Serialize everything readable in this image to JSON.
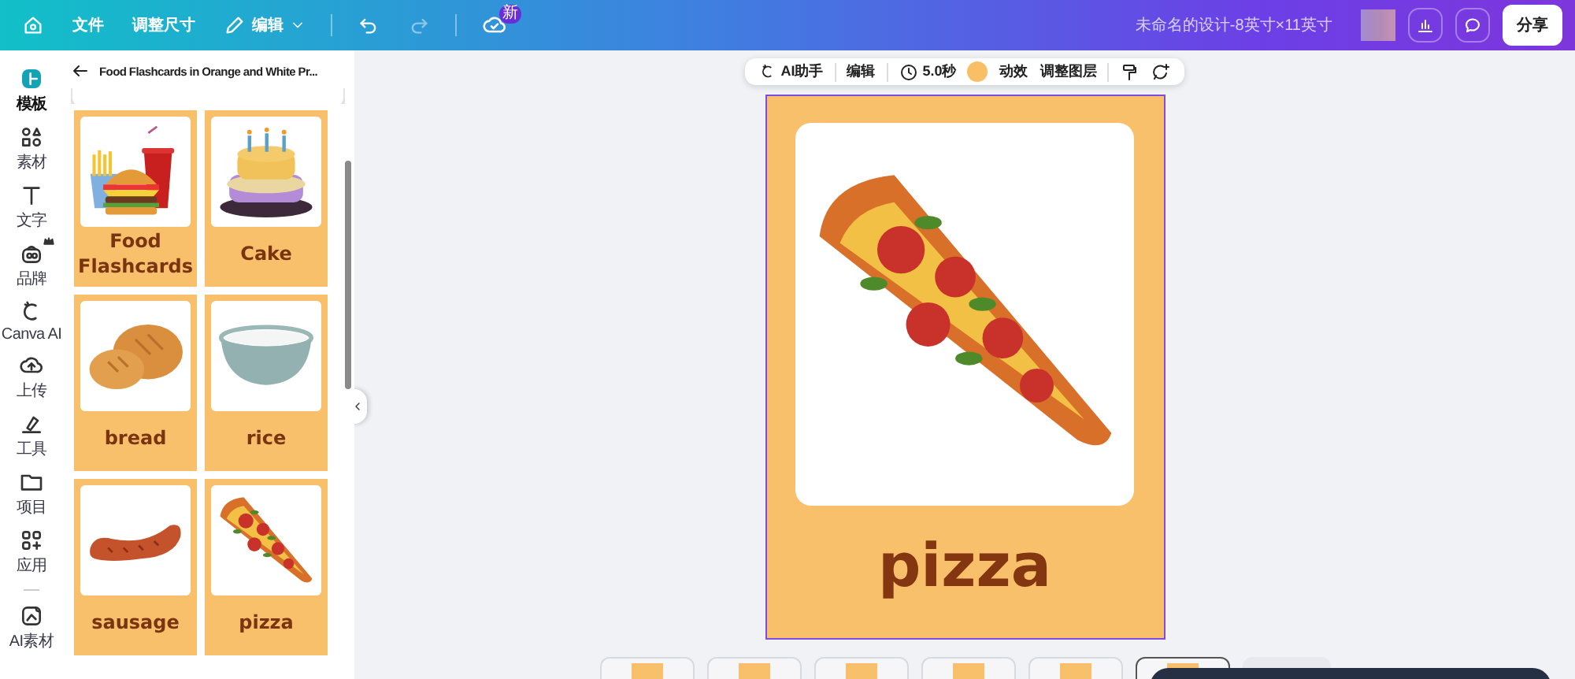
{
  "topbar": {
    "menu": [
      {
        "label": "文件"
      },
      {
        "label": "调整尺寸"
      }
    ],
    "edit_menu": {
      "label": "编辑"
    },
    "undo": {
      "disabled": false
    },
    "redo": {
      "disabled": true
    },
    "cloud_badge": "新",
    "design_title": "未命名的设计-8英寸×11英寸",
    "share_button": "分享"
  },
  "rail": [
    {
      "label": "模板",
      "kind": "template",
      "selected": true
    },
    {
      "label": "素材",
      "kind": "elements",
      "selected": false
    },
    {
      "label": "文字",
      "kind": "text",
      "selected": false
    },
    {
      "label": "品牌",
      "kind": "brand",
      "selected": false
    },
    {
      "label": "Canva AI",
      "kind": "ai",
      "selected": false
    },
    {
      "label": "上传",
      "kind": "upload",
      "selected": false
    },
    {
      "label": "工具",
      "kind": "tools",
      "selected": false
    },
    {
      "label": "项目",
      "kind": "projects",
      "selected": false
    },
    {
      "label": "应用",
      "kind": "apps",
      "selected": false
    },
    {
      "label": "AI素材",
      "kind": "aiasset",
      "selected": false
    }
  ],
  "panel": {
    "title": "Food Flashcards in Orange and White Pr...",
    "cards": [
      {
        "label": "Food Flashcards",
        "kind": "burger"
      },
      {
        "label": "Cake",
        "kind": "cake"
      },
      {
        "label": "bread",
        "kind": "bread"
      },
      {
        "label": "rice",
        "kind": "rice"
      },
      {
        "label": "sausage",
        "kind": "sausage"
      },
      {
        "label": "pizza",
        "kind": "pizza"
      }
    ]
  },
  "toolbar": [
    {
      "kind": "ai",
      "label": "AI助手"
    },
    {
      "kind": "divider"
    },
    {
      "kind": "text",
      "label": "编辑"
    },
    {
      "kind": "divider"
    },
    {
      "kind": "duration",
      "label": "5.0秒"
    },
    {
      "kind": "color",
      "color": "#f9bf66"
    },
    {
      "kind": "text",
      "label": "动效"
    },
    {
      "kind": "text",
      "label": "调整图层"
    },
    {
      "kind": "divider"
    },
    {
      "kind": "roller"
    },
    {
      "kind": "comment"
    }
  ],
  "page": {
    "word": "pizza",
    "kind": "pizza",
    "selected": true
  },
  "pages": [
    {
      "selected": false
    },
    {
      "selected": false
    },
    {
      "selected": false
    },
    {
      "selected": false
    },
    {
      "selected": false
    },
    {
      "selected": true
    }
  ]
}
